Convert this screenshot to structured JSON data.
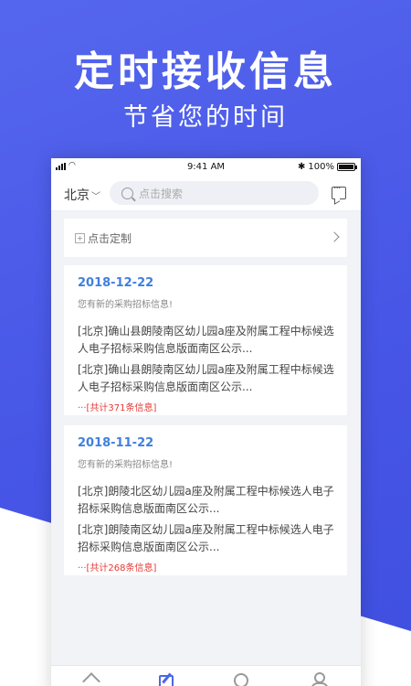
{
  "promo": {
    "headline": "定时接收信息",
    "subline": "节省您的时间"
  },
  "status_bar": {
    "time": "9:41 AM",
    "battery_text": "100%",
    "bluetooth": "✱"
  },
  "header": {
    "city": "北京",
    "search_placeholder": "点击搜索"
  },
  "custom": {
    "label": "点击定制"
  },
  "cards": [
    {
      "date": "2018-12-22",
      "subtitle": "您有新的采购招标信息!",
      "items": [
        "[北京]确山县朗陵南区幼儿园a座及附属工程中标候选人电子招标采购信息版面南区公示...",
        "[北京]确山县朗陵南区幼儿园a座及附属工程中标候选人电子招标采购信息版面南区公示..."
      ],
      "total": "···[共计371条信息]"
    },
    {
      "date": "2018-11-22",
      "subtitle": "您有新的采购招标信息!",
      "items": [
        "[北京]朗陵北区幼儿园a座及附属工程中标候选人电子招标采购信息版面南区公示...",
        "[北京]朗陵南区幼儿园a座及附属工程中标候选人电子招标采购信息版面南区公示..."
      ],
      "total": "···[共计268条信息]"
    }
  ],
  "colors": {
    "brand": "#4a67e8",
    "date": "#3f7fe0",
    "total": "#e53935"
  },
  "icons": {
    "tab_home": "home-icon",
    "tab_edit": "edit-icon",
    "tab_search": "search-icon",
    "tab_user": "user-icon"
  }
}
